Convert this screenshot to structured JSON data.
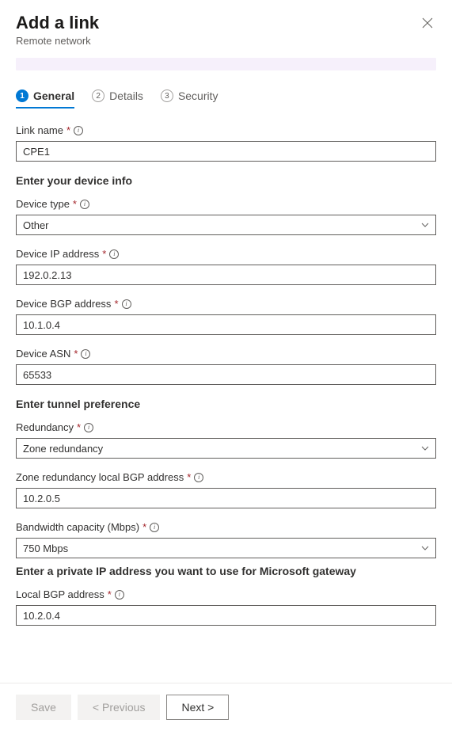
{
  "header": {
    "title": "Add a link",
    "subtitle": "Remote network"
  },
  "tabs": [
    {
      "num": "1",
      "label": "General",
      "active": true
    },
    {
      "num": "2",
      "label": "Details",
      "active": false
    },
    {
      "num": "3",
      "label": "Security",
      "active": false
    }
  ],
  "form": {
    "linkName": {
      "label": "Link name",
      "value": "CPE1"
    },
    "deviceInfoHeading": "Enter your device info",
    "deviceType": {
      "label": "Device type",
      "value": "Other"
    },
    "deviceIp": {
      "label": "Device IP address",
      "value": "192.0.2.13"
    },
    "deviceBgp": {
      "label": "Device BGP address",
      "value": "10.1.0.4"
    },
    "deviceAsn": {
      "label": "Device ASN",
      "value": "65533"
    },
    "tunnelHeading": "Enter tunnel preference",
    "redundancy": {
      "label": "Redundancy",
      "value": "Zone redundancy"
    },
    "zoneLocalBgp": {
      "label": "Zone redundancy local BGP address",
      "value": "10.2.0.5"
    },
    "bandwidth": {
      "label": "Bandwidth capacity (Mbps)",
      "value": "750 Mbps"
    },
    "gatewayHeading": "Enter a private IP address you want to use for Microsoft gateway",
    "localBgp": {
      "label": "Local BGP address",
      "value": "10.2.0.4"
    }
  },
  "footer": {
    "save": "Save",
    "previous": "< Previous",
    "next": "Next >"
  }
}
